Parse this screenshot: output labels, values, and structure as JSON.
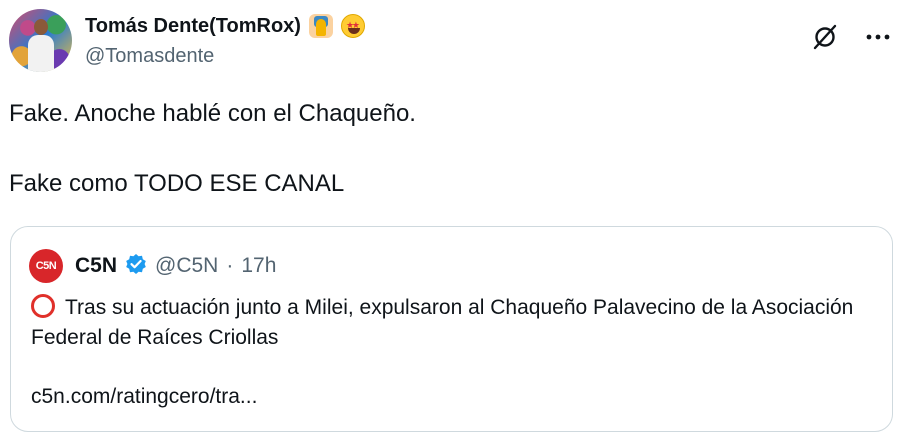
{
  "author": {
    "display_name": "Tomás Dente(TomRox)",
    "handle": "@Tomasdente",
    "emojis": [
      "person-raising-hand-emoji",
      "star-struck-emoji"
    ]
  },
  "tweet": {
    "line1": "Fake. Anoche hablé con el Chaqueño.",
    "line2": "Fake como TODO ESE CANAL"
  },
  "quoted": {
    "logo_text": "C5N",
    "name": "C5N",
    "handle": "@C5N",
    "separator": "·",
    "time": "17h",
    "text": "Tras su actuación junto a Milei, expulsaron al Chaqueño Palavecino de la Asociación Federal de Raíces Criollas",
    "link": "c5n.com/ratingcero/tra..."
  },
  "icons": {
    "grok": "grok-icon",
    "more": "more-options-icon",
    "verified": "verified-badge-icon",
    "status": "red-circle-icon"
  },
  "colors": {
    "verified": "#1d9bf0",
    "c5n_red": "#d8262a",
    "muted": "#536471"
  }
}
